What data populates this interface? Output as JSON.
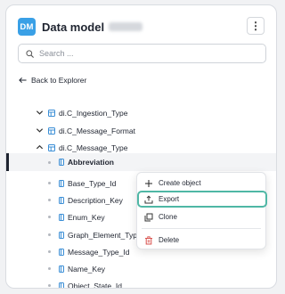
{
  "header": {
    "logo_text": "DM",
    "title": "Data model",
    "menu_glyph": "⋮"
  },
  "search": {
    "placeholder": "Search ..."
  },
  "back_link": {
    "label": "Back to Explorer"
  },
  "tree": {
    "types": [
      {
        "label": "di.C_Ingestion_Type",
        "expanded": false
      },
      {
        "label": "di.C_Message_Format",
        "expanded": false
      },
      {
        "label": "di.C_Message_Type",
        "expanded": true
      }
    ],
    "fields": [
      {
        "label": "Abbreviation",
        "selected": true
      },
      {
        "label": "Base_Type_Id",
        "selected": false
      },
      {
        "label": "Description_Key",
        "selected": false
      },
      {
        "label": "Enum_Key",
        "selected": false
      },
      {
        "label": "Graph_Element_Type",
        "selected": false
      },
      {
        "label": "Message_Type_Id",
        "selected": false
      },
      {
        "label": "Name_Key",
        "selected": false
      },
      {
        "label": "Object_State_Id",
        "selected": false
      }
    ]
  },
  "context_menu": {
    "items": [
      {
        "label": "Create object",
        "icon": "plus-icon"
      },
      {
        "label": "Export",
        "icon": "export-icon",
        "active": true
      },
      {
        "label": "Clone",
        "icon": "clone-icon"
      },
      {
        "label": "Delete",
        "icon": "trash-icon",
        "danger": true
      }
    ]
  },
  "colors": {
    "accent": "#3aa0e6",
    "focus_ring": "#4fb7a5",
    "danger": "#d9534f"
  }
}
